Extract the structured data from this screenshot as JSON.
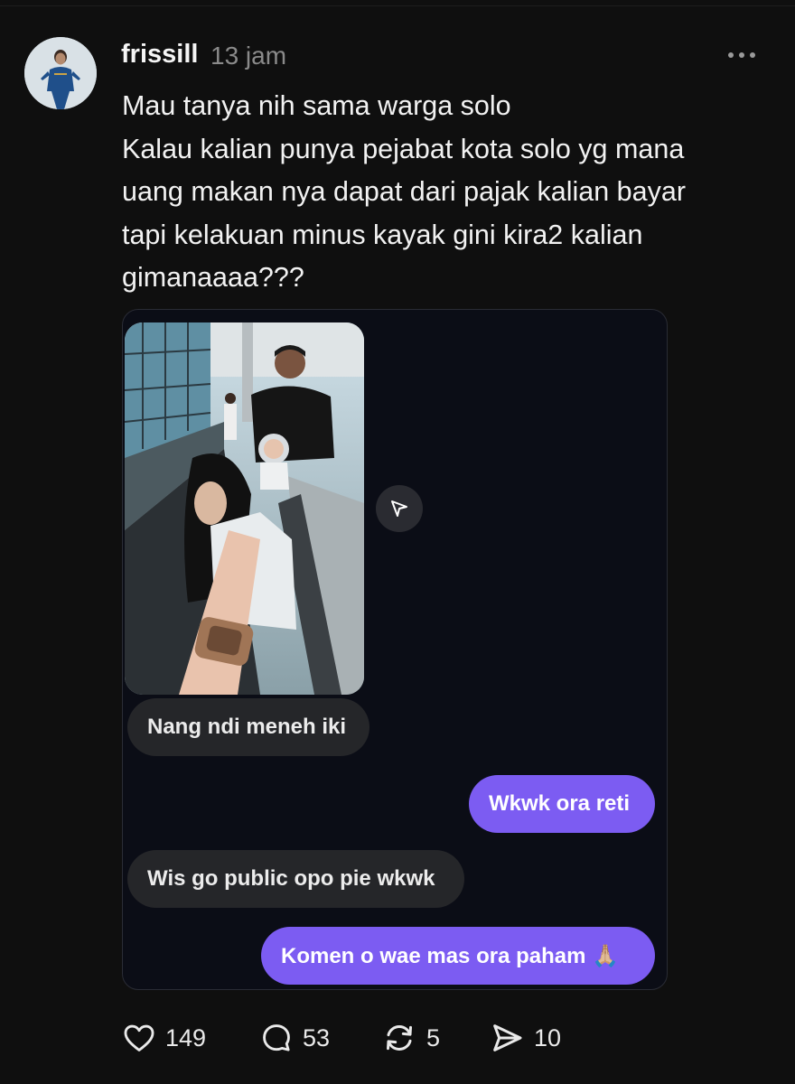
{
  "post": {
    "username": "frissill",
    "time": "13 jam",
    "text": "Mau tanya nih sama warga solo\nKalau kalian punya pejabat kota solo yg mana\nuang makan nya dapat dari pajak kalian bayar\ntapi kelakuan minus kayak gini kira2 kalian\ngimanaaaa???"
  },
  "chat": {
    "messages": [
      {
        "side": "in",
        "text": "Nang ndi meneh iki"
      },
      {
        "side": "out",
        "text": "Wkwk ora reti"
      },
      {
        "side": "in",
        "text": "Wis go public opo pie wkwk"
      },
      {
        "side": "out",
        "text": "Komen o wae mas ora paham 🙏🏼"
      }
    ]
  },
  "actions": {
    "likes": "149",
    "comments": "53",
    "reposts": "5",
    "shares": "10"
  },
  "colors": {
    "background": "#0f0f0f",
    "card": "#0b0d16",
    "outgoing_bubble": "#7c5cf2",
    "incoming_bubble": "#252629",
    "muted_text": "#8a8a8a"
  },
  "icons": [
    "more-icon",
    "share-arrow-icon",
    "heart-icon",
    "comment-icon",
    "repost-icon",
    "send-icon"
  ]
}
